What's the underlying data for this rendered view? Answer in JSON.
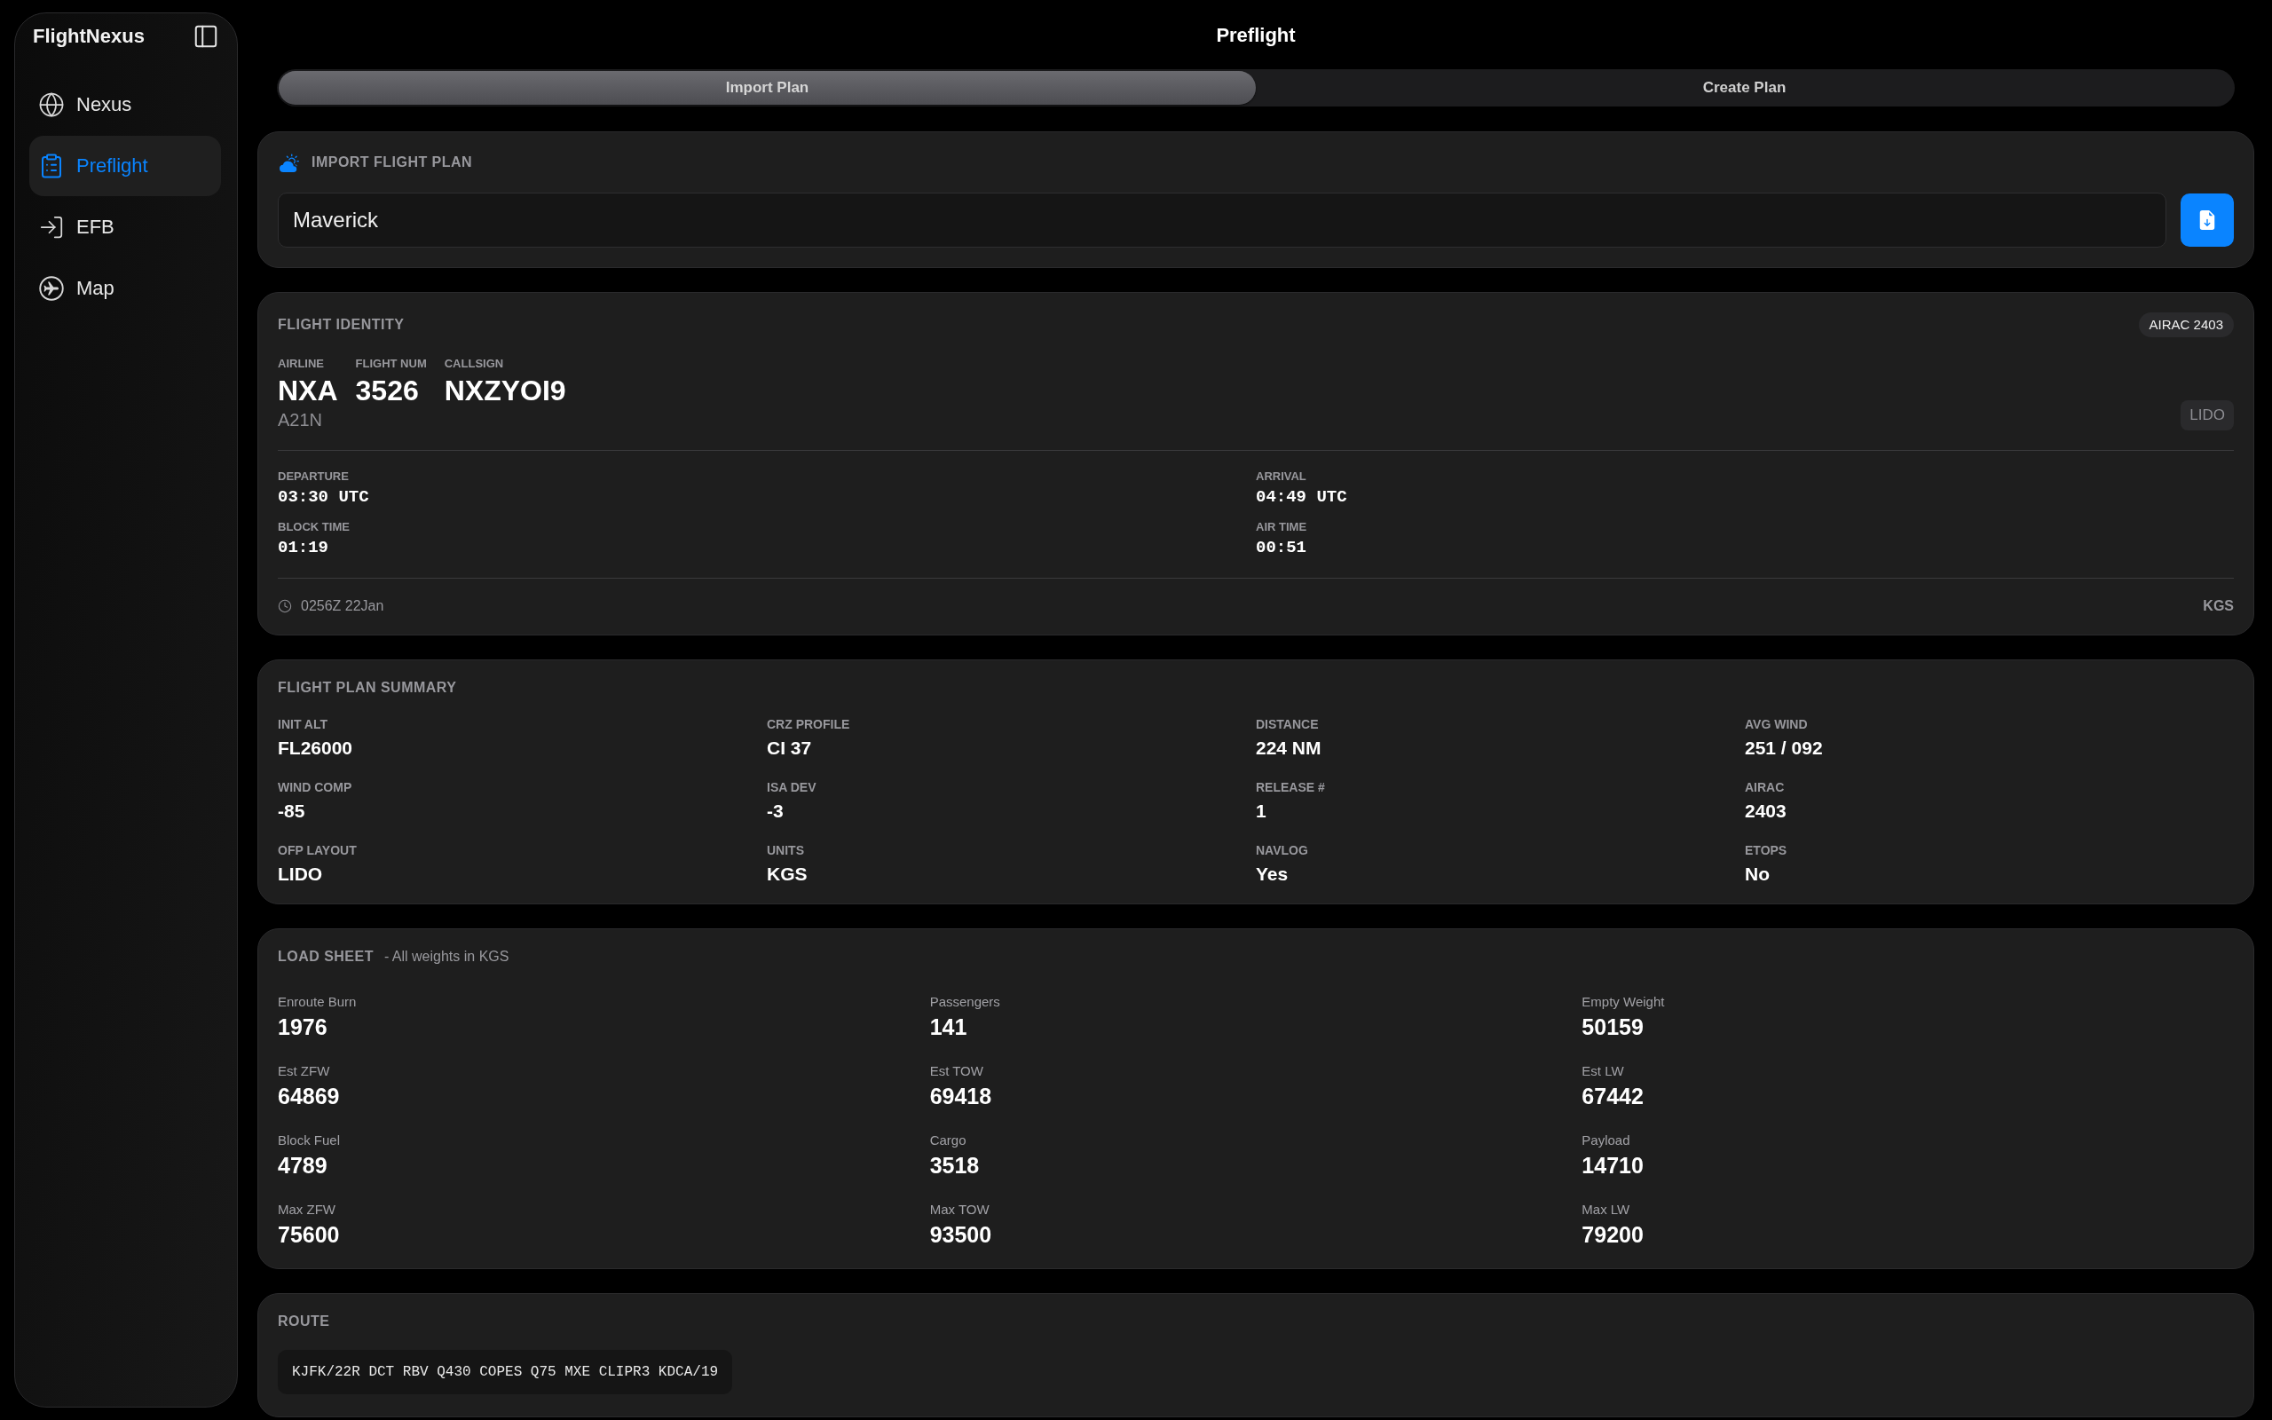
{
  "sidebar": {
    "title": "FlightNexus",
    "items": [
      {
        "label": "Nexus",
        "selected": false
      },
      {
        "label": "Preflight",
        "selected": true
      },
      {
        "label": "EFB",
        "selected": false
      },
      {
        "label": "Map",
        "selected": false
      }
    ]
  },
  "header": {
    "title": "Preflight"
  },
  "segments": [
    {
      "label": "Import Plan",
      "selected": true
    },
    {
      "label": "Create Plan",
      "selected": false
    }
  ],
  "import_plan": {
    "title": "IMPORT FLIGHT PLAN",
    "input": {
      "value": "Maverick"
    }
  },
  "flight_identity": {
    "title": "FLIGHT IDENTITY",
    "airac_badge": "AIRAC 2403",
    "fields": [
      {
        "label": "AIRLINE",
        "value": "NXA"
      },
      {
        "label": "FLIGHT NUM",
        "value": "3526"
      },
      {
        "label": "CALLSIGN",
        "value": "NXZYOI9"
      }
    ],
    "aircraft": "A21N",
    "layout_badge": "LIDO",
    "times": [
      {
        "label": "DEPARTURE",
        "value": "03:30 UTC"
      },
      {
        "label": "ARRIVAL",
        "value": "04:49 UTC"
      },
      {
        "label": "BLOCK TIME",
        "value": "01:19"
      },
      {
        "label": "AIR TIME",
        "value": "00:51"
      }
    ],
    "generated": "0256Z 22Jan",
    "units": "KGS"
  },
  "flight_plan_summary": {
    "title": "FLIGHT PLAN SUMMARY",
    "fields": [
      {
        "label": "INIT ALT",
        "value": "FL26000"
      },
      {
        "label": "CRZ PROFILE",
        "value": "CI 37"
      },
      {
        "label": "DISTANCE",
        "value": "224 NM"
      },
      {
        "label": "AVG WIND",
        "value": "251 / 092"
      },
      {
        "label": "WIND COMP",
        "value": "-85"
      },
      {
        "label": "ISA DEV",
        "value": "-3"
      },
      {
        "label": "RELEASE #",
        "value": "1"
      },
      {
        "label": "AIRAC",
        "value": "2403"
      },
      {
        "label": "OFP LAYOUT",
        "value": "LIDO"
      },
      {
        "label": "UNITS",
        "value": "KGS"
      },
      {
        "label": "NAVLOG",
        "value": "Yes"
      },
      {
        "label": "ETOPS",
        "value": "No"
      }
    ]
  },
  "load_sheet": {
    "title": "LOAD SHEET",
    "subtitle": "- All weights in KGS",
    "fields": [
      {
        "label": "Enroute Burn",
        "value": "1976"
      },
      {
        "label": "Passengers",
        "value": "141"
      },
      {
        "label": "Empty Weight",
        "value": "50159"
      },
      {
        "label": "Est ZFW",
        "value": "64869"
      },
      {
        "label": "Est TOW",
        "value": "69418"
      },
      {
        "label": "Est LW",
        "value": "67442"
      },
      {
        "label": "Block Fuel",
        "value": "4789"
      },
      {
        "label": "Cargo",
        "value": "3518"
      },
      {
        "label": "Payload",
        "value": "14710"
      },
      {
        "label": "Max ZFW",
        "value": "75600"
      },
      {
        "label": "Max TOW",
        "value": "93500"
      },
      {
        "label": "Max LW",
        "value": "79200"
      }
    ]
  },
  "route": {
    "title": "ROUTE",
    "text": "KJFK/22R DCT RBV Q430 COPES Q75 MXE CLIPR3 KDCA/19"
  }
}
